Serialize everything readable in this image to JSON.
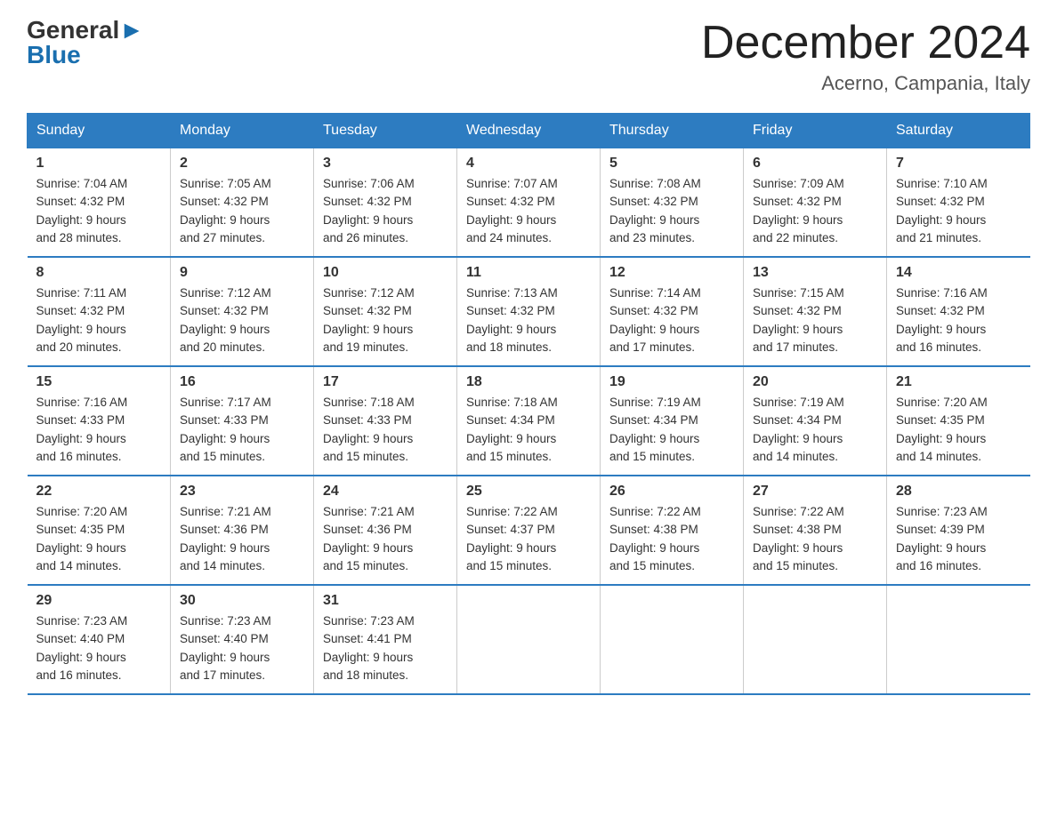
{
  "header": {
    "logo_general": "General",
    "logo_blue": "Blue",
    "month_title": "December 2024",
    "location": "Acerno, Campania, Italy"
  },
  "days_of_week": [
    "Sunday",
    "Monday",
    "Tuesday",
    "Wednesday",
    "Thursday",
    "Friday",
    "Saturday"
  ],
  "weeks": [
    [
      {
        "day": "1",
        "sunrise": "7:04 AM",
        "sunset": "4:32 PM",
        "daylight": "9 hours and 28 minutes."
      },
      {
        "day": "2",
        "sunrise": "7:05 AM",
        "sunset": "4:32 PM",
        "daylight": "9 hours and 27 minutes."
      },
      {
        "day": "3",
        "sunrise": "7:06 AM",
        "sunset": "4:32 PM",
        "daylight": "9 hours and 26 minutes."
      },
      {
        "day": "4",
        "sunrise": "7:07 AM",
        "sunset": "4:32 PM",
        "daylight": "9 hours and 24 minutes."
      },
      {
        "day": "5",
        "sunrise": "7:08 AM",
        "sunset": "4:32 PM",
        "daylight": "9 hours and 23 minutes."
      },
      {
        "day": "6",
        "sunrise": "7:09 AM",
        "sunset": "4:32 PM",
        "daylight": "9 hours and 22 minutes."
      },
      {
        "day": "7",
        "sunrise": "7:10 AM",
        "sunset": "4:32 PM",
        "daylight": "9 hours and 21 minutes."
      }
    ],
    [
      {
        "day": "8",
        "sunrise": "7:11 AM",
        "sunset": "4:32 PM",
        "daylight": "9 hours and 20 minutes."
      },
      {
        "day": "9",
        "sunrise": "7:12 AM",
        "sunset": "4:32 PM",
        "daylight": "9 hours and 20 minutes."
      },
      {
        "day": "10",
        "sunrise": "7:12 AM",
        "sunset": "4:32 PM",
        "daylight": "9 hours and 19 minutes."
      },
      {
        "day": "11",
        "sunrise": "7:13 AM",
        "sunset": "4:32 PM",
        "daylight": "9 hours and 18 minutes."
      },
      {
        "day": "12",
        "sunrise": "7:14 AM",
        "sunset": "4:32 PM",
        "daylight": "9 hours and 17 minutes."
      },
      {
        "day": "13",
        "sunrise": "7:15 AM",
        "sunset": "4:32 PM",
        "daylight": "9 hours and 17 minutes."
      },
      {
        "day": "14",
        "sunrise": "7:16 AM",
        "sunset": "4:32 PM",
        "daylight": "9 hours and 16 minutes."
      }
    ],
    [
      {
        "day": "15",
        "sunrise": "7:16 AM",
        "sunset": "4:33 PM",
        "daylight": "9 hours and 16 minutes."
      },
      {
        "day": "16",
        "sunrise": "7:17 AM",
        "sunset": "4:33 PM",
        "daylight": "9 hours and 15 minutes."
      },
      {
        "day": "17",
        "sunrise": "7:18 AM",
        "sunset": "4:33 PM",
        "daylight": "9 hours and 15 minutes."
      },
      {
        "day": "18",
        "sunrise": "7:18 AM",
        "sunset": "4:34 PM",
        "daylight": "9 hours and 15 minutes."
      },
      {
        "day": "19",
        "sunrise": "7:19 AM",
        "sunset": "4:34 PM",
        "daylight": "9 hours and 15 minutes."
      },
      {
        "day": "20",
        "sunrise": "7:19 AM",
        "sunset": "4:34 PM",
        "daylight": "9 hours and 14 minutes."
      },
      {
        "day": "21",
        "sunrise": "7:20 AM",
        "sunset": "4:35 PM",
        "daylight": "9 hours and 14 minutes."
      }
    ],
    [
      {
        "day": "22",
        "sunrise": "7:20 AM",
        "sunset": "4:35 PM",
        "daylight": "9 hours and 14 minutes."
      },
      {
        "day": "23",
        "sunrise": "7:21 AM",
        "sunset": "4:36 PM",
        "daylight": "9 hours and 14 minutes."
      },
      {
        "day": "24",
        "sunrise": "7:21 AM",
        "sunset": "4:36 PM",
        "daylight": "9 hours and 15 minutes."
      },
      {
        "day": "25",
        "sunrise": "7:22 AM",
        "sunset": "4:37 PM",
        "daylight": "9 hours and 15 minutes."
      },
      {
        "day": "26",
        "sunrise": "7:22 AM",
        "sunset": "4:38 PM",
        "daylight": "9 hours and 15 minutes."
      },
      {
        "day": "27",
        "sunrise": "7:22 AM",
        "sunset": "4:38 PM",
        "daylight": "9 hours and 15 minutes."
      },
      {
        "day": "28",
        "sunrise": "7:23 AM",
        "sunset": "4:39 PM",
        "daylight": "9 hours and 16 minutes."
      }
    ],
    [
      {
        "day": "29",
        "sunrise": "7:23 AM",
        "sunset": "4:40 PM",
        "daylight": "9 hours and 16 minutes."
      },
      {
        "day": "30",
        "sunrise": "7:23 AM",
        "sunset": "4:40 PM",
        "daylight": "9 hours and 17 minutes."
      },
      {
        "day": "31",
        "sunrise": "7:23 AM",
        "sunset": "4:41 PM",
        "daylight": "9 hours and 18 minutes."
      },
      null,
      null,
      null,
      null
    ]
  ],
  "labels": {
    "sunrise": "Sunrise:",
    "sunset": "Sunset:",
    "daylight": "Daylight:"
  }
}
